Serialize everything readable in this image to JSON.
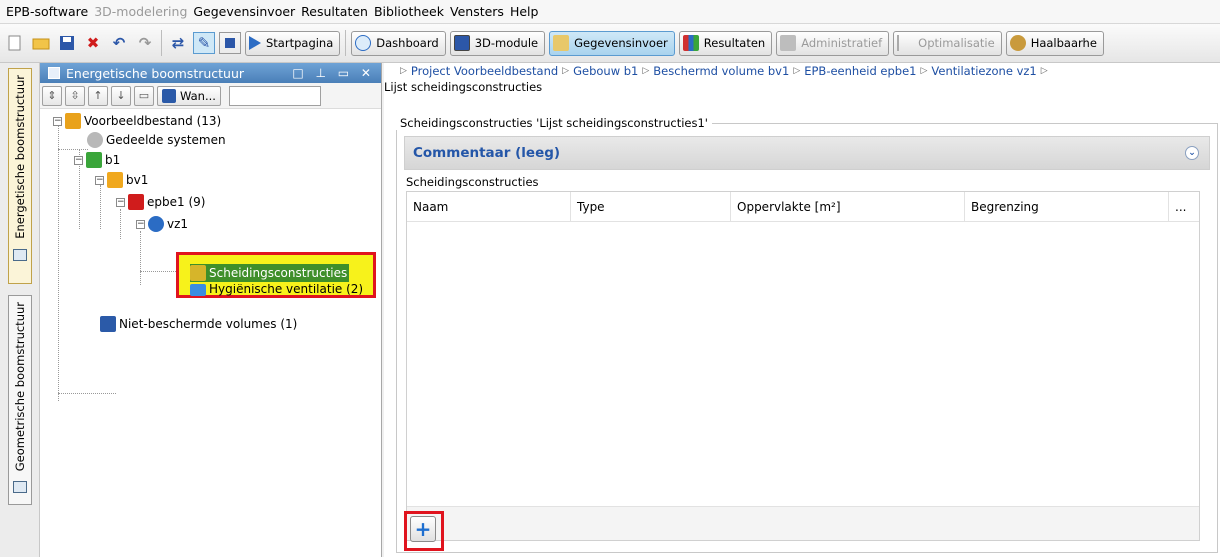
{
  "menubar": {
    "items": [
      "EPB-software",
      "3D-modelering",
      "Gegevensinvoer",
      "Resultaten",
      "Bibliotheek",
      "Vensters",
      "Help"
    ],
    "disabled_index": 1
  },
  "toolbar": {
    "icons": [
      "new-icon",
      "open-icon",
      "save-icon",
      "delete-icon",
      "undo-icon",
      "redo-icon",
      "refresh-icon",
      "tool-icon",
      "window-icon"
    ],
    "buttons": [
      {
        "label": "Startpagina",
        "state": "normal"
      },
      {
        "label": "Dashboard",
        "state": "normal"
      },
      {
        "label": "3D-module",
        "state": "normal"
      },
      {
        "label": "Gegevensinvoer",
        "state": "active"
      },
      {
        "label": "Resultaten",
        "state": "normal"
      },
      {
        "label": "Administratief",
        "state": "disabled"
      },
      {
        "label": "Optimalisatie",
        "state": "disabled"
      },
      {
        "label": "Haalbaarhe",
        "state": "normal"
      }
    ]
  },
  "vtabs": [
    "Energetische boomstructuur",
    "Geometrische boomstructuur"
  ],
  "leftpanel": {
    "title": "Energetische boomstructuur",
    "window_controls": "□ ⊥ ▭ ✕",
    "filter_label": "Wan...",
    "tree": [
      {
        "label": "Voorbeeldbestand (13)",
        "icon_color": "#e9a21b"
      },
      {
        "label": "Gedeelde systemen",
        "icon_color": "#b8b8b8"
      },
      {
        "label": "b1",
        "icon_color": "#3aa53a"
      },
      {
        "label": "bv1",
        "icon_color": "#f0a81e"
      },
      {
        "label": "epbe1 (9)",
        "icon_color": "#d01c1c"
      },
      {
        "label": "vz1",
        "icon_color": "#2b6cc4"
      },
      {
        "label": "Scheidingsconstructies",
        "icon_color": "#d6b52a"
      },
      {
        "label": "Hygiënische ventilatie (2)",
        "icon_color": "#3b8de0"
      },
      {
        "label": "Niet-beschermde volumes (1)",
        "icon_color": "#2b5aa8"
      }
    ]
  },
  "rightpanel": {
    "breadcrumb": [
      "Project Voorbeeldbestand",
      "Gebouw b1",
      "Beschermd volume bv1",
      "EPB-eenheid epbe1",
      "Ventilatiezone vz1"
    ],
    "breadcrumb_tail": "Lijst scheidingsconstructies",
    "section_title": "Scheidingsconstructies 'Lijst scheidingsconstructies1'",
    "comment_label": "Commentaar (leeg)",
    "subsection_label": "Scheidingsconstructies",
    "columns": [
      "Naam",
      "Type",
      "Oppervlakte [m²]",
      "Begrenzing",
      "..."
    ],
    "add_button_symbol": "+"
  },
  "colors": {
    "highlight": "#f7f21b",
    "annotation_red": "#e0141e",
    "link_blue": "#1e4fa3"
  }
}
